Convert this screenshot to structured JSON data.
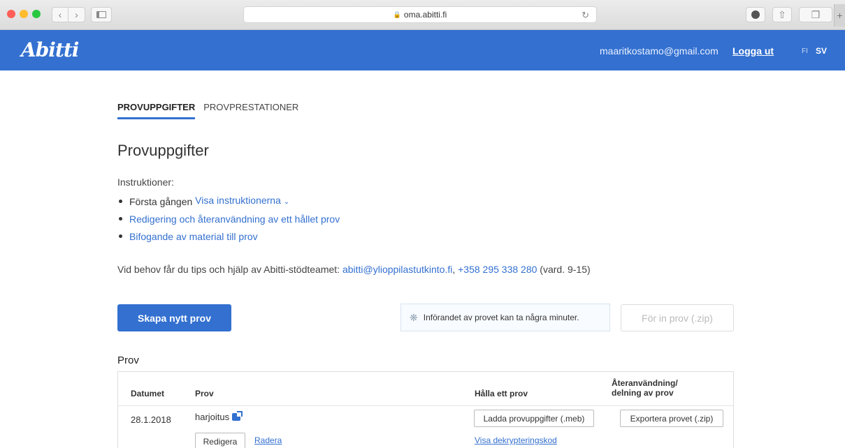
{
  "browser": {
    "url": "oma.abitti.fi"
  },
  "header": {
    "logo": "Abitti",
    "email": "maaritkostamo@gmail.com",
    "logout": "Logga ut",
    "lang_fi": "FI",
    "lang_sv": "SV"
  },
  "tabs": [
    {
      "label": "PROVUPPGIFTER",
      "active": true
    },
    {
      "label": "PROVPRESTATIONER",
      "active": false
    }
  ],
  "page_title": "Provuppgifter",
  "instructions": {
    "label": "Instruktioner:",
    "items": [
      {
        "prefix": "Första gången ",
        "link": "Visa instruktionerna"
      },
      {
        "link": "Redigering och återanvändning av ett hållet prov"
      },
      {
        "link": "Bifogande av material till prov"
      }
    ]
  },
  "help": {
    "text": "Vid behov får du tips och hjälp av Abitti-stödteamet: ",
    "email": "abitti@ylioppilastutkinto.fi",
    "sep": ", ",
    "phone": "+358 295 338 280",
    "hours": " (vard. 9-15)"
  },
  "actions": {
    "create": "Skapa nytt prov",
    "notice": "Införandet av provet kan ta några minuter.",
    "import": "För in prov (.zip)"
  },
  "exams": {
    "title": "Prov",
    "columns": [
      "Datumet",
      "Prov",
      "Hålla ett prov",
      "Återanvändning/ delning av prov"
    ],
    "rows": [
      {
        "date": "28.1.2018",
        "name": "harjoitus",
        "edit": "Redigera",
        "delete": "Radera",
        "load": "Ladda provuppgifter (.meb)",
        "decrypt": "Visa dekrypteringskod",
        "export": "Exportera provet (.zip)"
      }
    ]
  }
}
